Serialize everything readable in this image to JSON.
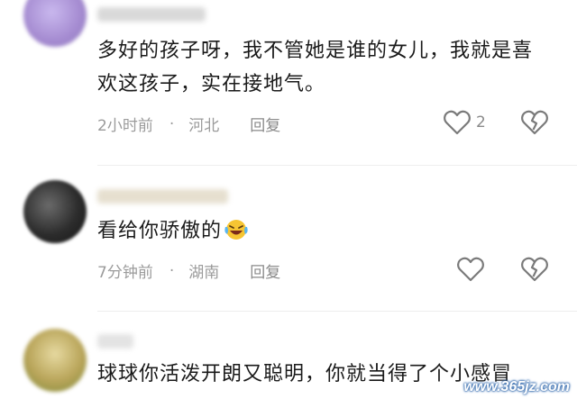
{
  "comments": [
    {
      "text_line1": "多好的孩子呀，我不管她是谁的女儿，我就是喜",
      "text_line2": "欢这孩子，实在接地气。",
      "time": "2小时前",
      "location": "河北",
      "reply": "回复",
      "like_count": "2",
      "avatar_color": "#b3a0d8"
    },
    {
      "text": "看给你骄傲的",
      "emoji": "laughing-crying-emoji",
      "time": "7分钟前",
      "location": "湖南",
      "reply": "回复",
      "avatar_color": "#3a3a3a"
    },
    {
      "text": "球球你活泼开朗又聪明，你就当得了个小感冒",
      "avatar_color": "#c8b86a"
    }
  ],
  "watermark": "www.365jz.com",
  "icons": {
    "like": "heart-outline-icon",
    "dislike": "broken-heart-icon"
  },
  "separator": "·"
}
